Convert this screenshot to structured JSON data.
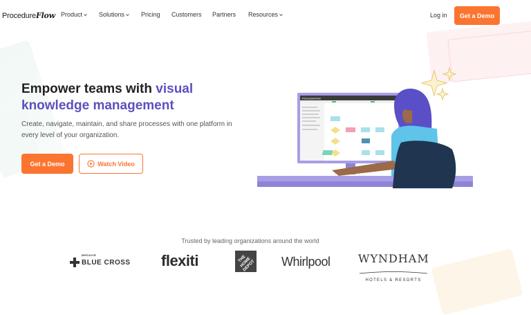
{
  "header": {
    "logo_text": "Procedure",
    "logo_emphasis": "Flow",
    "nav": [
      {
        "label": "Product",
        "has_dropdown": true
      },
      {
        "label": "Solutions",
        "has_dropdown": true
      },
      {
        "label": "Pricing",
        "has_dropdown": false
      },
      {
        "label": "Customers",
        "has_dropdown": false
      },
      {
        "label": "Partners",
        "has_dropdown": false
      },
      {
        "label": "Resources",
        "has_dropdown": true
      }
    ],
    "login_label": "Log in",
    "demo_label": "Get a Demo"
  },
  "hero": {
    "title_line1": "Empower teams with ",
    "title_accent1": "visual",
    "title_accent2": "knowledge management",
    "subtitle": "Create, navigate, maintain, and share processes with one platform in every level of your organization.",
    "demo_label": "Get a Demo",
    "video_label": "Watch Video",
    "screen_logo": "ProcedureFlow"
  },
  "trusted": {
    "heading": "Trusted by leading organizations around the world",
    "logos": [
      {
        "name": "medavie-blue-cross",
        "top": "MEDAVIE",
        "main": "BLUE CROSS"
      },
      {
        "name": "flexiti",
        "main": "flexiti"
      },
      {
        "name": "the-home-depot",
        "main": "THE HOME DEPOT"
      },
      {
        "name": "whirlpool",
        "main": "Whirlpool"
      },
      {
        "name": "wyndham",
        "main": "WYNDHAM",
        "sub": "HOTELS & RESORTS"
      }
    ]
  },
  "colors": {
    "accent_orange": "#fb7531",
    "accent_purple": "#5b50bd",
    "text_dark": "#222222"
  }
}
